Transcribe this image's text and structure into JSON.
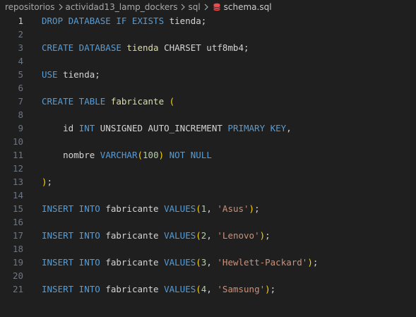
{
  "breadcrumb": {
    "items": [
      "repositorios",
      "actividad13_lamp_dockers",
      "sql"
    ],
    "file": "schema.sql",
    "file_icon": "database-icon"
  },
  "editor": {
    "active_line": 1,
    "lines": [
      {
        "n": "1",
        "tokens": [
          [
            "kw",
            "DROP DATABASE IF EXISTS"
          ],
          [
            "plain",
            " tienda;"
          ]
        ]
      },
      {
        "n": "2",
        "tokens": []
      },
      {
        "n": "3",
        "tokens": [
          [
            "kw",
            "CREATE DATABASE"
          ],
          [
            "plain",
            " "
          ],
          [
            "fn",
            "tienda"
          ],
          [
            "plain",
            " CHARSET utf8mb4;"
          ]
        ]
      },
      {
        "n": "4",
        "tokens": []
      },
      {
        "n": "5",
        "tokens": [
          [
            "kw",
            "USE"
          ],
          [
            "plain",
            " tienda;"
          ]
        ]
      },
      {
        "n": "6",
        "tokens": []
      },
      {
        "n": "7",
        "tokens": [
          [
            "kw",
            "CREATE TABLE"
          ],
          [
            "plain",
            " "
          ],
          [
            "fn",
            "fabricante"
          ],
          [
            "plain",
            " "
          ],
          [
            "paren",
            "("
          ]
        ]
      },
      {
        "n": "8",
        "tokens": []
      },
      {
        "n": "9",
        "tokens": [
          [
            "plain",
            "    id "
          ],
          [
            "kw",
            "INT"
          ],
          [
            "plain",
            " UNSIGNED AUTO_INCREMENT "
          ],
          [
            "kw",
            "PRIMARY KEY"
          ],
          [
            "plain",
            ","
          ]
        ]
      },
      {
        "n": "10",
        "tokens": []
      },
      {
        "n": "11",
        "tokens": [
          [
            "plain",
            "    nombre "
          ],
          [
            "kw",
            "VARCHAR"
          ],
          [
            "paren",
            "("
          ],
          [
            "num",
            "100"
          ],
          [
            "paren",
            ")"
          ],
          [
            "plain",
            " "
          ],
          [
            "kw",
            "NOT NULL"
          ]
        ]
      },
      {
        "n": "12",
        "tokens": []
      },
      {
        "n": "13",
        "tokens": [
          [
            "paren",
            ")"
          ],
          [
            "plain",
            ";"
          ]
        ]
      },
      {
        "n": "14",
        "tokens": []
      },
      {
        "n": "15",
        "tokens": [
          [
            "kw",
            "INSERT INTO"
          ],
          [
            "plain",
            " fabricante "
          ],
          [
            "kw",
            "VALUES"
          ],
          [
            "paren",
            "("
          ],
          [
            "num",
            "1"
          ],
          [
            "plain",
            ", "
          ],
          [
            "str",
            "'Asus'"
          ],
          [
            "paren",
            ")"
          ],
          [
            "plain",
            ";"
          ]
        ]
      },
      {
        "n": "16",
        "tokens": []
      },
      {
        "n": "17",
        "tokens": [
          [
            "kw",
            "INSERT INTO"
          ],
          [
            "plain",
            " fabricante "
          ],
          [
            "kw",
            "VALUES"
          ],
          [
            "paren",
            "("
          ],
          [
            "num",
            "2"
          ],
          [
            "plain",
            ", "
          ],
          [
            "str",
            "'Lenovo'"
          ],
          [
            "paren",
            ")"
          ],
          [
            "plain",
            ";"
          ]
        ]
      },
      {
        "n": "18",
        "tokens": []
      },
      {
        "n": "19",
        "tokens": [
          [
            "kw",
            "INSERT INTO"
          ],
          [
            "plain",
            " fabricante "
          ],
          [
            "kw",
            "VALUES"
          ],
          [
            "paren",
            "("
          ],
          [
            "num",
            "3"
          ],
          [
            "plain",
            ", "
          ],
          [
            "str",
            "'Hewlett-Packard'"
          ],
          [
            "paren",
            ")"
          ],
          [
            "plain",
            ";"
          ]
        ]
      },
      {
        "n": "20",
        "tokens": []
      },
      {
        "n": "21",
        "tokens": [
          [
            "kw",
            "INSERT INTO"
          ],
          [
            "plain",
            " fabricante "
          ],
          [
            "kw",
            "VALUES"
          ],
          [
            "paren",
            "("
          ],
          [
            "num",
            "4"
          ],
          [
            "plain",
            ", "
          ],
          [
            "str",
            "'Samsung'"
          ],
          [
            "paren",
            ")"
          ],
          [
            "plain",
            ";"
          ]
        ]
      }
    ]
  },
  "colors": {
    "background": "#1f1f1f",
    "keyword": "#569cd6",
    "identifier": "#dcdcaa",
    "string": "#ce9178",
    "number": "#b5cea8",
    "bracket": "#ffd700",
    "text": "#d4d4d4",
    "line_number": "#6e7681",
    "active_line_number": "#cccccc",
    "file_icon": "#f14c4c"
  }
}
